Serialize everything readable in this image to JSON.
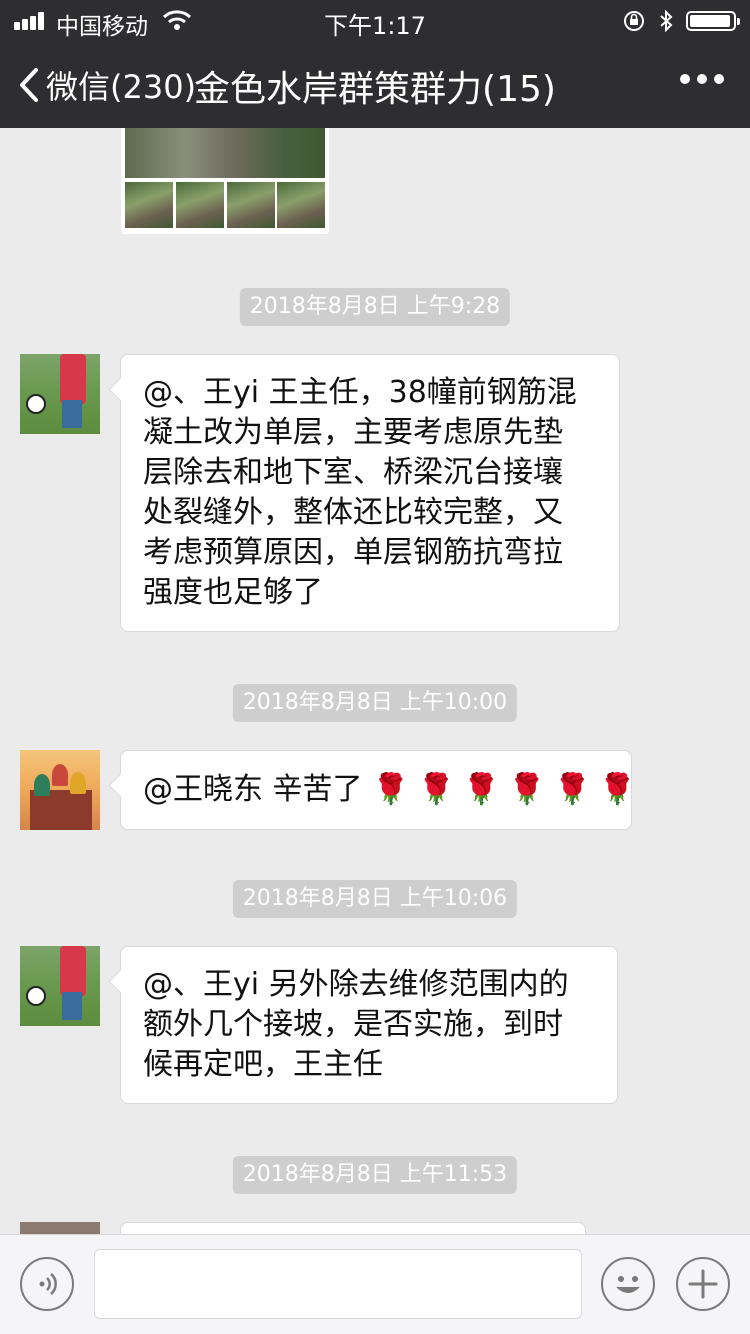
{
  "status_bar": {
    "carrier": "中国移动",
    "time": "下午1:17"
  },
  "nav": {
    "back_label": "微信(230)",
    "title": "金色水岸群策群力(15)"
  },
  "messages": [
    {
      "timestamp": "2018年8月8日 上午9:28",
      "text_lines": [
        "@、王yi 王主任，38幢前钢筋混",
        "凝土改为单层，主要考虑原先垫",
        "层除去和地下室、桥梁沉台接壤",
        "处裂缝外，整体还比较完整，又",
        "考虑预算原因，单层钢筋抗弯拉",
        "强度也足够了"
      ]
    },
    {
      "timestamp": "2018年8月8日 上午10:00",
      "text": "@王晓东 辛苦了",
      "emoji": "🌹🌹🌹🌹🌹🌹"
    },
    {
      "timestamp": "2018年8月8日 上午10:06",
      "text_lines": [
        "@、王yi 另外除去维修范围内的",
        "额外几个接坡，是否实施，到时",
        "候再定吧，王主任"
      ]
    },
    {
      "timestamp": "2018年8月8日 上午11:53"
    }
  ],
  "icons": {
    "signal": "signal-bars-icon",
    "wifi": "wifi-icon",
    "lock": "orientation-lock-icon",
    "bluetooth": "bluetooth-icon",
    "battery": "battery-icon",
    "back": "chevron-left-icon",
    "more": "more-dots-icon",
    "voice": "voice-icon",
    "emoji": "smiley-icon",
    "plus": "plus-icon"
  },
  "colors": {
    "nav_bg": "#2e2e30",
    "chat_bg": "#ebebeb",
    "timestamp_chip": "#cecece"
  }
}
